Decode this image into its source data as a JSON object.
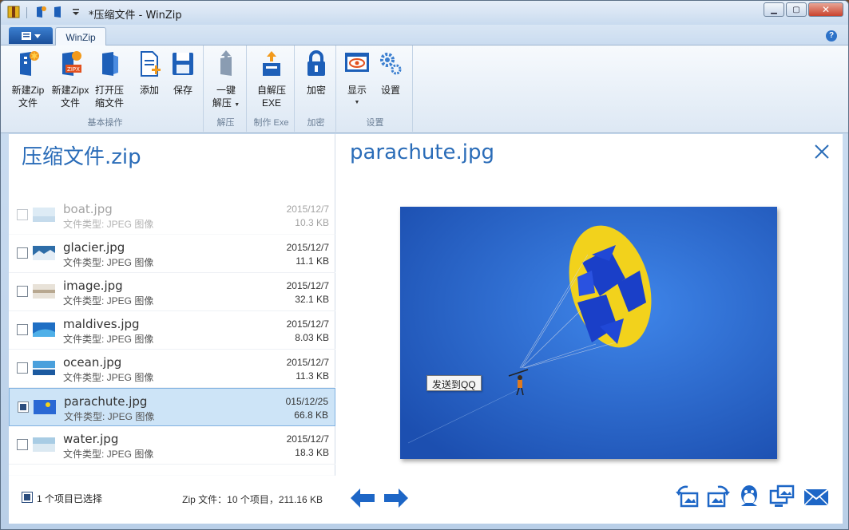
{
  "window": {
    "title": "*压缩文件 - WinZip"
  },
  "ribbon": {
    "tab": "WinZip",
    "groups": [
      {
        "label": "基本操作",
        "buttons": [
          {
            "line1": "新建Zip",
            "line2": "文件"
          },
          {
            "line1": "新建Zipx",
            "line2": "文件"
          },
          {
            "line1": "打开压",
            "line2": "缩文件"
          },
          {
            "line1": "添加",
            "line2": ""
          },
          {
            "line1": "保存",
            "line2": ""
          }
        ]
      },
      {
        "label": "解压",
        "buttons": [
          {
            "line1": "一键",
            "line2": "解压"
          }
        ]
      },
      {
        "label": "制作 Exe",
        "buttons": [
          {
            "line1": "自解压",
            "line2": "EXE"
          }
        ]
      },
      {
        "label": "加密",
        "buttons": [
          {
            "line1": "加密",
            "line2": ""
          }
        ]
      },
      {
        "label": "设置",
        "buttons": [
          {
            "line1": "显示",
            "line2": ""
          },
          {
            "line1": "设置",
            "line2": ""
          }
        ]
      }
    ],
    "zipx_badge": "ZIPX"
  },
  "archive": {
    "title": "压缩文件.zip",
    "files": [
      {
        "name": "boat.jpg",
        "type": "文件类型: JPEG 图像",
        "date": "2015/12/7",
        "size": "10.3 KB"
      },
      {
        "name": "glacier.jpg",
        "type": "文件类型: JPEG 图像",
        "date": "2015/12/7",
        "size": "11.1 KB"
      },
      {
        "name": "image.jpg",
        "type": "文件类型: JPEG 图像",
        "date": "2015/12/7",
        "size": "32.1 KB"
      },
      {
        "name": "maldives.jpg",
        "type": "文件类型: JPEG 图像",
        "date": "2015/12/7",
        "size": "8.03 KB"
      },
      {
        "name": "ocean.jpg",
        "type": "文件类型: JPEG 图像",
        "date": "2015/12/7",
        "size": "11.3 KB"
      },
      {
        "name": "parachute.jpg",
        "type": "文件类型: JPEG 图像",
        "date": "015/12/25",
        "size": "66.8 KB"
      },
      {
        "name": "water.jpg",
        "type": "文件类型: JPEG 图像",
        "date": "2015/12/7",
        "size": "18.3 KB"
      }
    ],
    "selection_status": "1 个项目已选择",
    "summary": "Zip 文件：10 个项目，211.16 KB"
  },
  "preview": {
    "title": "parachute.jpg",
    "tooltip": "发送到QQ"
  },
  "colors": {
    "accent": "#2a6cb8",
    "selected_row": "#cde4f7",
    "photo_sky": "#2a68d4"
  }
}
